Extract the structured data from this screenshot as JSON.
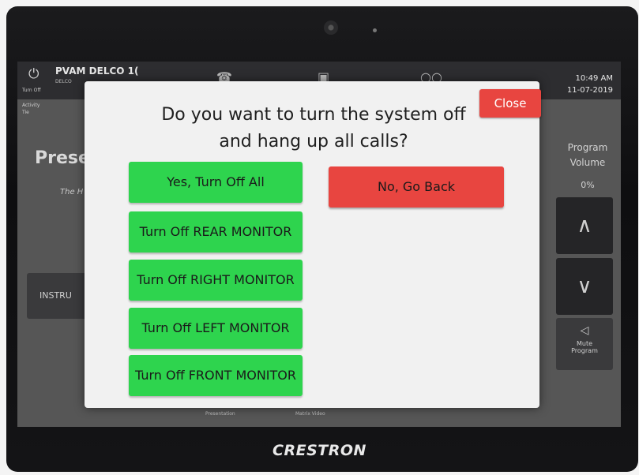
{
  "device": {
    "brand": "CRESTRON"
  },
  "header": {
    "power_label": "Turn Off",
    "room_title": "PVAM DELCO 1(",
    "room_subtitle": "DELCO",
    "time": "10:49 AM",
    "date": "11-07-2019"
  },
  "background": {
    "activity_label": "Activity",
    "activity_sub": "Tie",
    "title": "Prese",
    "subtitle": "The H",
    "instructions_button": "INSTRU",
    "volume_label": "Program Volume",
    "volume_percent": "0%",
    "mute_label": "Mute Program",
    "tab_presentation": "Presentation",
    "tab_matrix": "Matrix Video"
  },
  "modal": {
    "close_label": "Close",
    "question_line1": "Do you want to turn the system off",
    "question_line2": "and hang up all calls?",
    "yes_all": "Yes, Turn Off All",
    "no_back": "No, Go Back",
    "options": [
      "Turn Off REAR MONITOR",
      "Turn Off RIGHT MONITOR",
      "Turn Off LEFT MONITOR",
      "Turn Off FRONT MONITOR"
    ]
  },
  "colors": {
    "green": "#2ed44e",
    "red": "#e84540",
    "modal_bg": "#f1f1f1"
  }
}
